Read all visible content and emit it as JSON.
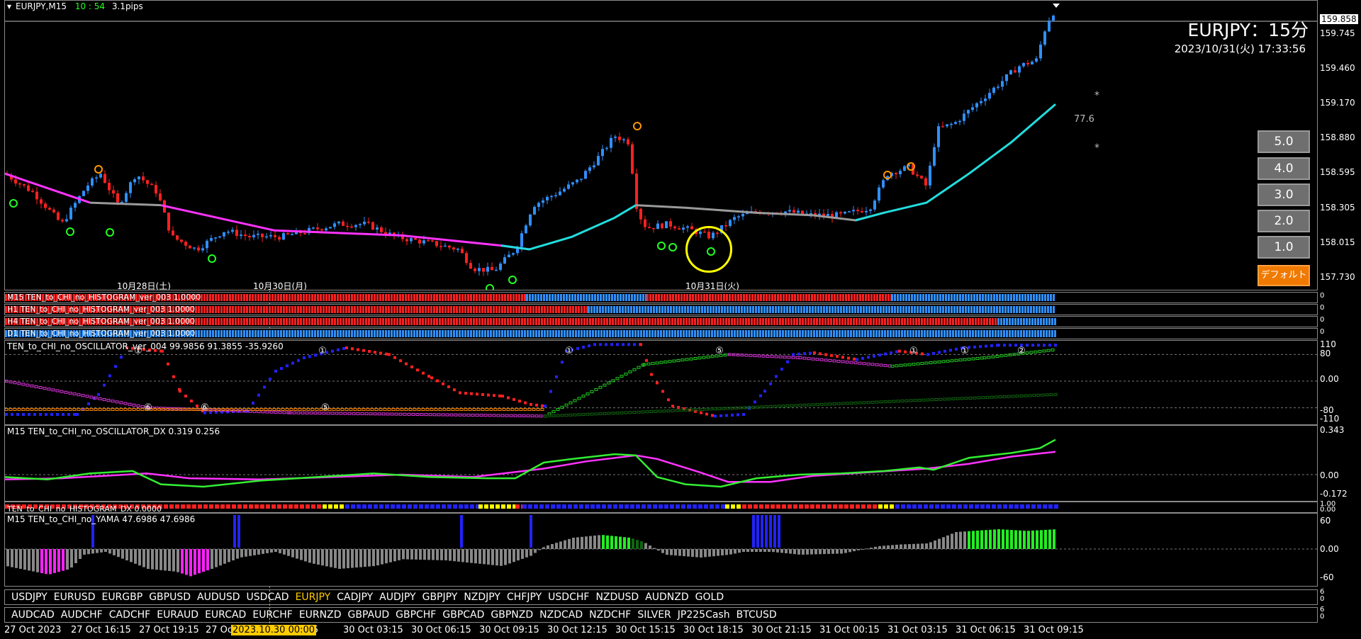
{
  "chart_info": {
    "symbol_tf": "EURJPY,M15",
    "time_left": "10 : 54",
    "spread": "3.1pips",
    "big_title": "EURJPY：15分",
    "datetime": "2023/10/31(火) 17:33:56",
    "current_price": "159.858",
    "ma_label": "77.6",
    "star": "*",
    "price_scale": [
      "159.745",
      "159.460",
      "159.170",
      "158.880",
      "158.595",
      "158.305",
      "158.015",
      "157.730"
    ],
    "day_labels": [
      "10月28日(土)",
      "10月30日(月)",
      "10月31日(火)"
    ]
  },
  "tf_buttons": [
    "5.0",
    "4.0",
    "3.0",
    "2.0",
    "1.0",
    "デフォルト"
  ],
  "histogram_strips": [
    "M15 TEN_to_CHI_no_HISTOGRAM_ver_003 1.0000",
    "H1 TEN_to_CHI_no_HISTOGRAM_ver_003 1.0000",
    "H4 TEN_to_CHI_no_HISTOGRAM_ver_003 1.0000",
    "D1 TEN_to_CHI_no_HISTOGRAM_ver_003 1.0000"
  ],
  "strip_scale": "0",
  "oscillator": {
    "title": "TEN_to_CHI_no_OSCILLATOR_ver_004 99.9856 91.3855 -35.9260",
    "scale": [
      "110",
      "80",
      "0.00",
      "-80",
      "-110"
    ],
    "markers": [
      "①",
      "⑥",
      "⑥",
      "⑤",
      "①",
      "①",
      "⑤",
      "①",
      "①",
      "②"
    ]
  },
  "dx": {
    "title": "M15 TEN_to_CHI_no_OSCILLATOR_DX  0.319 0.256",
    "scale": [
      "0.343",
      "0.00",
      "-0.172"
    ]
  },
  "hist_dx": {
    "title": "TEN_to_CHI_no_HISTOGRAM_DX 0.0000",
    "scale": [
      "1.00",
      "0.00"
    ]
  },
  "yama": {
    "title": "M15  TEN_to_CHI_no_YAMA  47.6986 47.6986",
    "scale": [
      "60",
      "0.00",
      "-60"
    ]
  },
  "symbols_row1": [
    "USDJPY",
    "EURUSD",
    "EURGBP",
    "GBPUSD",
    "AUDUSD",
    "USDCAD",
    "EURJPY",
    "CADJPY",
    "AUDJPY",
    "GBPJPY",
    "NZDJPY",
    "CHFJPY",
    "USDCHF",
    "NZDUSD",
    "AUDNZD",
    "GOLD"
  ],
  "symbols_row2": [
    "AUDCAD",
    "AUDCHF",
    "CADCHF",
    "EURAUD",
    "EURCAD",
    "EURCHF",
    "EURNZD",
    "GBPAUD",
    "GBPCHF",
    "GBPCAD",
    "GBPNZD",
    "NZDCAD",
    "NZDCHF",
    "SILVER",
    "JP225Cash",
    "BTCUSD"
  ],
  "symbol_row_scale": [
    "6",
    "0"
  ],
  "active_symbol": "EURJPY",
  "time_axis": [
    "27 Oct 2023",
    "27 Oct 16:15",
    "27 Oct 19:15",
    "27 Oc",
    "0:15",
    "30 Oct 03:15",
    "30 Oct 06:15",
    "30 Oct 09:15",
    "30 Oct 12:15",
    "30 Oct 15:15",
    "30 Oct 18:15",
    "30 Oct 21:15",
    "31 Oct 00:15",
    "31 Oct 03:15",
    "31 Oct 06:15",
    "31 Oct 09:15"
  ],
  "crosshair_time": "2023.10.30 00:00",
  "colors": {
    "bull": "#2f8fff",
    "bear": "#ff2020",
    "ma_up": "#22dddd",
    "ma_mid": "#9a9a9a",
    "ma_down": "#ff33ff",
    "accent_button": "#f07a00",
    "active_symbol": "#ffcc00"
  }
}
